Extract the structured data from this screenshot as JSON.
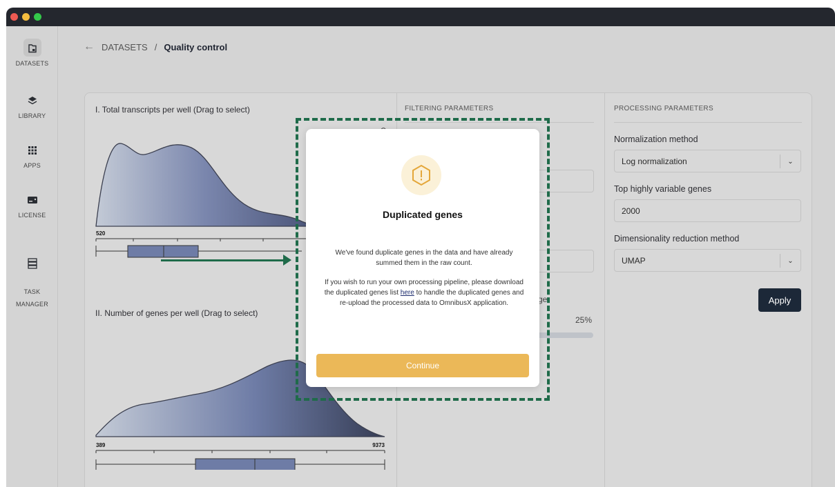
{
  "window": {
    "traffic_lights": [
      "close",
      "minimize",
      "maximize"
    ]
  },
  "sidebar": {
    "items": [
      {
        "label": "DATASETS",
        "icon": "folder-icon"
      },
      {
        "label": "LIBRARY",
        "icon": "layers-icon"
      },
      {
        "label": "APPS",
        "icon": "grid-icon"
      },
      {
        "label": "LICENSE",
        "icon": "card-icon"
      },
      {
        "label": "TASK\nMANAGER",
        "icon": "server-icon"
      }
    ]
  },
  "breadcrumb": {
    "root": "DATASETS",
    "separator": "/",
    "current": "Quality control"
  },
  "left_panel": {
    "chart1_title": "I. Total transcripts per well (Drag to select)",
    "chart1_min": "520",
    "chart2_title": "II. Number of genes per well (Drag to select)",
    "chart2_min": "389",
    "chart2_max": "9373"
  },
  "filtering": {
    "heading": "FILTERING PARAMETERS",
    "partial_label": "ge",
    "percent": "25%"
  },
  "processing": {
    "heading": "PROCESSING PARAMETERS",
    "normalization_label": "Normalization method",
    "normalization_value": "Log normalization",
    "hvg_label": "Top highly variable genes",
    "hvg_value": "2000",
    "dimred_label": "Dimensionality reduction method",
    "dimred_value": "UMAP",
    "apply_label": "Apply"
  },
  "modal": {
    "title": "Duplicated genes",
    "body1": "We've found duplicate genes in the data and have already summed them in the raw count.",
    "body2_before": "If you wish to run your own processing pipeline, please download the duplicated genes list",
    "body2_link": "here",
    "body2_after": "to handle the duplicated genes and re-upload the processed data to OmnibusX application.",
    "button": "Continue"
  },
  "colors": {
    "accent": "#ebb858",
    "dark_button": "#1c2838",
    "annotation_green": "#1f6b4a",
    "density_start": "#c3cad6",
    "density_mid": "#6e7ca6",
    "density_end": "#363d55"
  }
}
